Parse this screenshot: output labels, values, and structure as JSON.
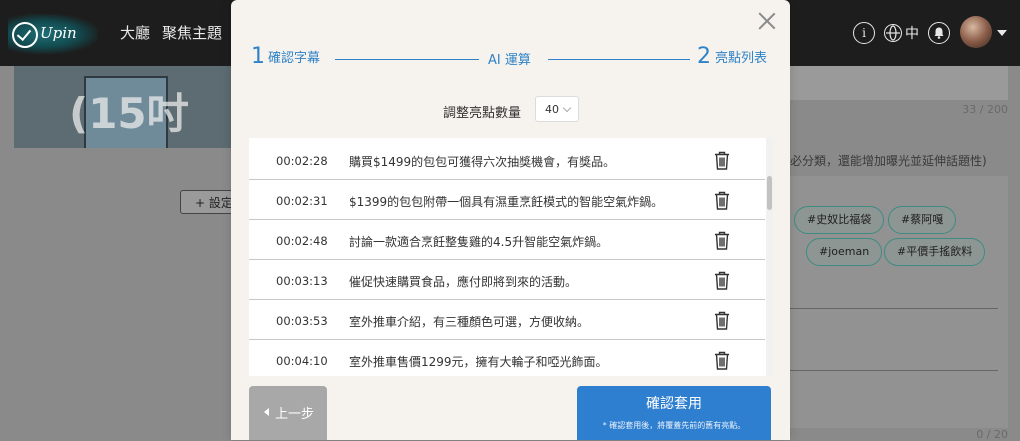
{
  "app": {
    "logo_text": "Upin",
    "nav": [
      "大廳",
      "聚焦主題"
    ],
    "language": "中",
    "info_icon": "info-icon",
    "globe_icon": "globe-icon",
    "bell_icon": "bell-icon"
  },
  "background": {
    "thumbnail_text": "(15吋",
    "char_count_top": "33 / 200",
    "char_count_bottom": "0 / 20",
    "set_button": "+ 設定",
    "hint": "必分類，還能增加曝光並延伸話題性)",
    "tags": [
      "#史奴比福袋",
      "#蔡阿嘎",
      "#joeman",
      "#平價手搖飲料"
    ]
  },
  "modal": {
    "steps": [
      {
        "num": "1",
        "label": "確認字幕"
      },
      {
        "num": "",
        "label": "AI 運算"
      },
      {
        "num": "2",
        "label": "亮點列表"
      }
    ],
    "count_label": "調整亮點數量",
    "count_value": "40",
    "highlights": [
      {
        "time": "00:02:28",
        "text": "購買$1499的包包可獲得六次抽獎機會，有獎品。"
      },
      {
        "time": "00:02:31",
        "text": "$1399的包包附帶一個具有濕重烹飪模式的智能空氣炸鍋。"
      },
      {
        "time": "00:02:48",
        "text": "討論一款適合烹飪整隻雞的4.5升智能空氣炸鍋。"
      },
      {
        "time": "00:03:13",
        "text": "催促快速購買食品，應付即將到來的活動。"
      },
      {
        "time": "00:03:53",
        "text": "室外推車介紹，有三種顏色可選，方便收納。"
      },
      {
        "time": "00:04:10",
        "text": "室外推車售價1299元，擁有大輪子和啞光飾面。"
      }
    ],
    "back_label": "上一步",
    "confirm_label": "確認套用",
    "confirm_note": "* 確認套用後，將覆蓋先前的舊有亮點。"
  },
  "colors": {
    "accent": "#2f82c7",
    "confirm": "#2f7fd0",
    "back": "#a8a8a8",
    "modal_bg": "#f6f3ee"
  }
}
